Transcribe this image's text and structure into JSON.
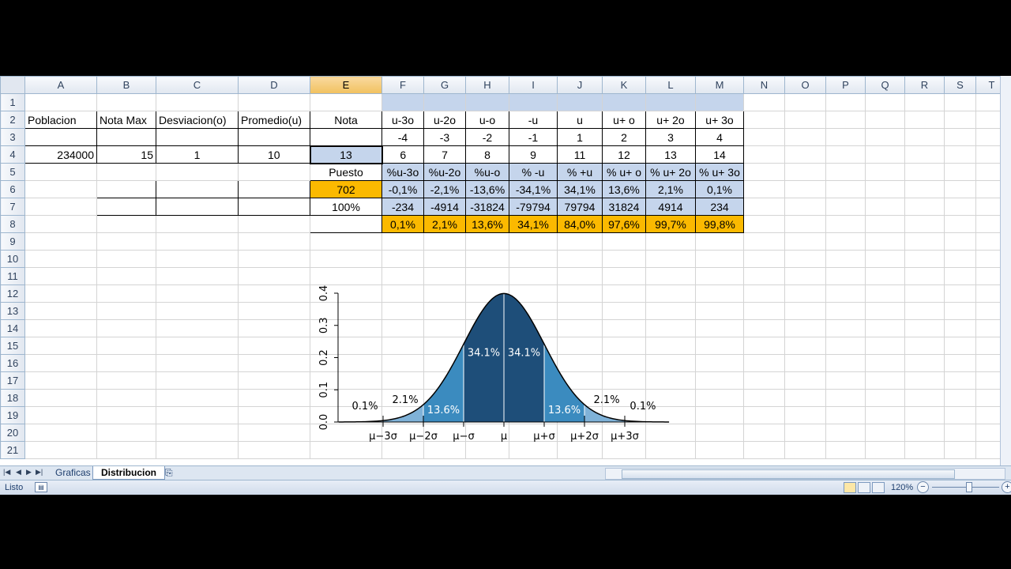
{
  "columns": [
    "A",
    "B",
    "C",
    "D",
    "E",
    "F",
    "G",
    "H",
    "I",
    "J",
    "K",
    "L",
    "M",
    "N",
    "O",
    "P",
    "Q",
    "R",
    "S",
    "T"
  ],
  "selected_column": "E",
  "row_numbers": [
    "1",
    "2",
    "3",
    "4",
    "5",
    "6",
    "7",
    "8",
    "9",
    "10",
    "11",
    "12",
    "13",
    "14",
    "15",
    "16",
    "17",
    "18",
    "19",
    "20",
    "21"
  ],
  "cells": {
    "A2": "Poblacion",
    "B2": "Nota Max",
    "C2": "Desviacion(o)",
    "D2": "Promedio(u)",
    "E2": "Nota",
    "F2": "u-3o",
    "G2": "u-2o",
    "H2": "u-o",
    "I2": "-u",
    "J2": "u",
    "K2": "u+ o",
    "L2": "u+ 2o",
    "M2": "u+ 3o",
    "F3": "-4",
    "G3": "-3",
    "H3": "-2",
    "I3": "-1",
    "J3": "1",
    "K3": "2",
    "L3": "3",
    "M3": "4",
    "A4": "234000",
    "B4": "15",
    "C4": "1",
    "D4": "10",
    "E4": "13",
    "F4": "6",
    "G4": "7",
    "H4": "8",
    "I4": "9",
    "J4": "11",
    "K4": "12",
    "L4": "13",
    "M4": "14",
    "E5": "Puesto",
    "F5": "%u-3o",
    "G5": "%u-2o",
    "H5": "%u-o",
    "I5": "% -u",
    "J5": "% +u",
    "K5": "% u+ o",
    "L5": "% u+ 2o",
    "M5": "% u+ 3o",
    "E6": "702",
    "F6": "-0,1%",
    "G6": "-2,1%",
    "H6": "-13,6%",
    "I6": "-34,1%",
    "J6": "34,1%",
    "K6": "13,6%",
    "L6": "2,1%",
    "M6": "0,1%",
    "E7": "100%",
    "F7": "-234",
    "G7": "-4914",
    "H7": "-31824",
    "I7": "-79794",
    "J7": "79794",
    "K7": "31824",
    "L7": "4914",
    "M7": "234",
    "F8": "0,1%",
    "G8": "2,1%",
    "H8": "13,6%",
    "I8": "34,1%",
    "J8": "84,0%",
    "K8": "97,6%",
    "L8": "99,7%",
    "M8": "99,8%"
  },
  "chart": {
    "y_ticks": [
      "0.0",
      "0.1",
      "0.2",
      "0.3",
      "0.4"
    ],
    "x_ticks": [
      "μ−3σ",
      "μ−2σ",
      "μ−σ",
      "μ",
      "μ+σ",
      "μ+2σ",
      "μ+3σ"
    ],
    "region_labels": [
      "0.1%",
      "2.1%",
      "13.6%",
      "34.1%",
      "34.1%",
      "13.6%",
      "2.1%",
      "0.1%"
    ],
    "colors": {
      "dark": "#1e4e79",
      "mid": "#3b8bbf",
      "light": "#7fb2d8",
      "lightest": "#a9c8e4"
    }
  },
  "sheet_tabs": [
    "Graficas",
    "Distribucion"
  ],
  "active_tab": "Distribucion",
  "status": {
    "ready": "Listo",
    "zoom": "120%"
  }
}
